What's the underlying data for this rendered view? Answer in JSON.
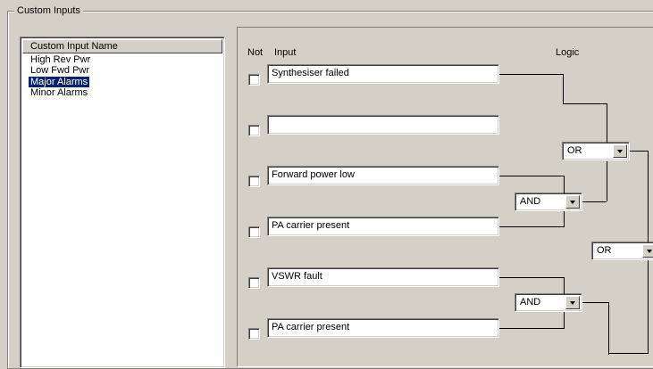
{
  "group": {
    "title": "Custom Inputs"
  },
  "list": {
    "header": "Custom Input Name",
    "items": [
      {
        "label": "High Rev Pwr",
        "selected": false
      },
      {
        "label": "Low Fwd Pwr",
        "selected": false
      },
      {
        "label": "Major Alarms",
        "selected": true
      },
      {
        "label": "Minor Alarms",
        "selected": false
      }
    ]
  },
  "logic_panel": {
    "headers": {
      "not": "Not",
      "input": "Input",
      "logic": "Logic"
    },
    "rows": [
      {
        "checked": false,
        "value": "Synthesiser failed"
      },
      {
        "checked": false,
        "value": ""
      },
      {
        "checked": false,
        "value": "Forward power low"
      },
      {
        "checked": false,
        "value": "PA carrier present"
      },
      {
        "checked": false,
        "value": "VSWR fault"
      },
      {
        "checked": false,
        "value": "PA carrier present"
      }
    ],
    "operators": {
      "or_top": "OR",
      "and_1": "AND",
      "or_right": "OR",
      "and_2": "AND"
    }
  }
}
